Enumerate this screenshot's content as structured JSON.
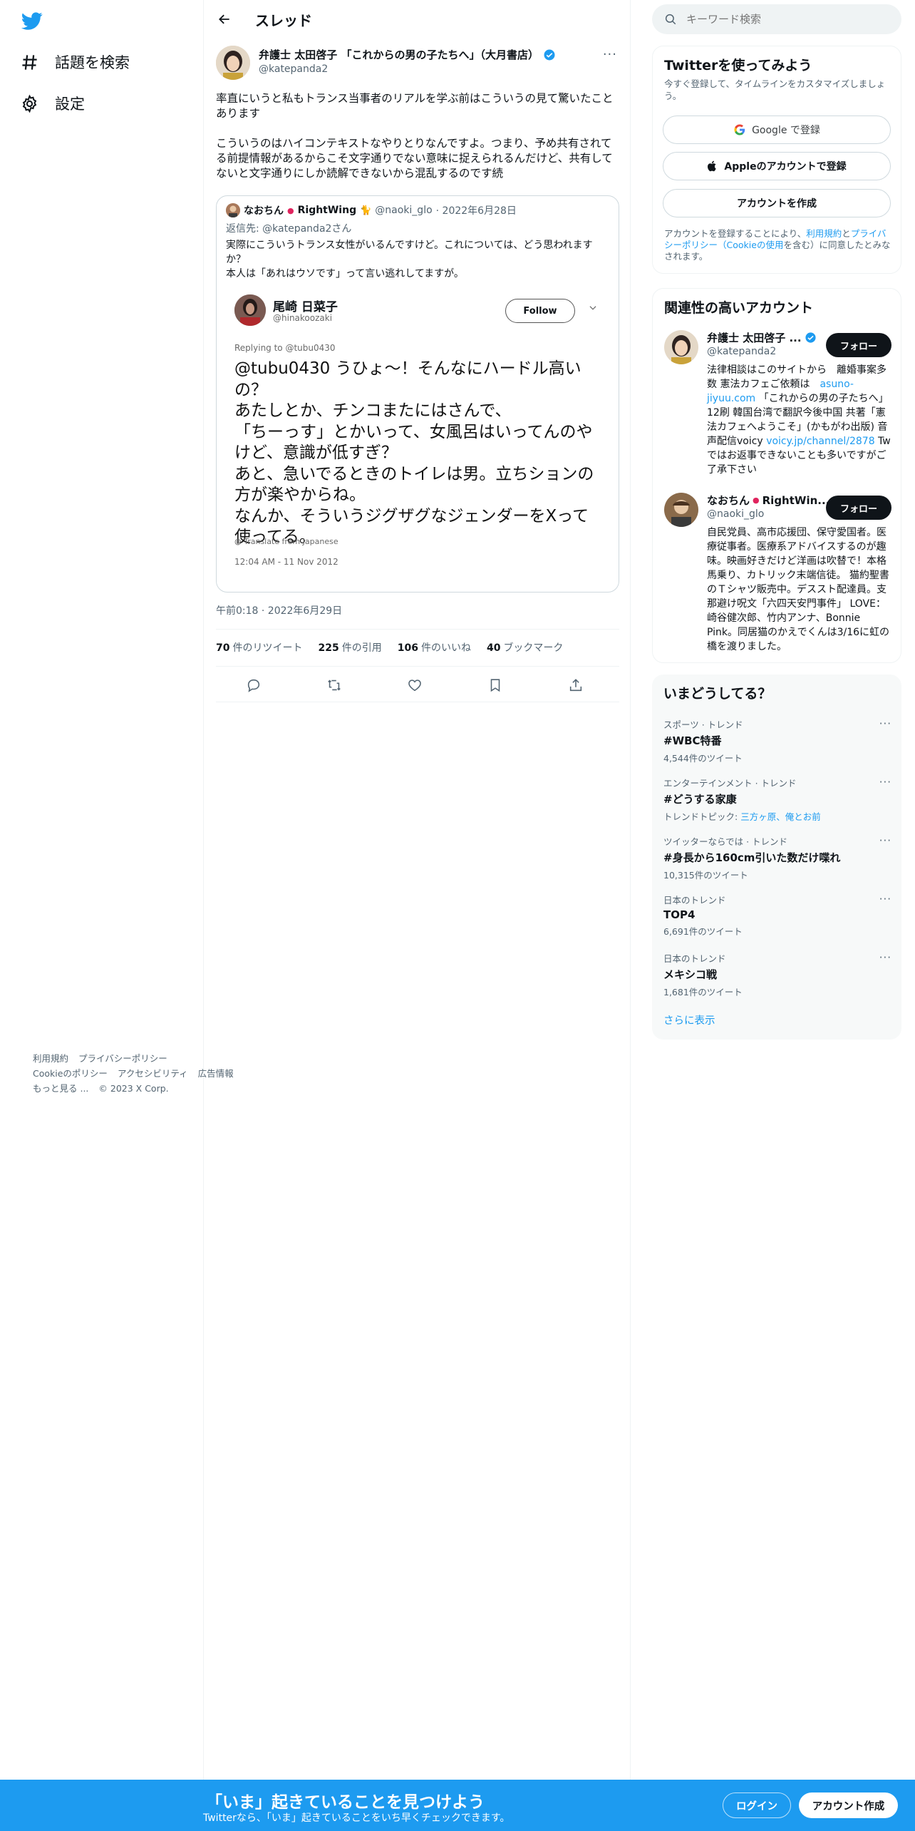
{
  "nav": {
    "items": [
      {
        "label": "話題を検索",
        "icon": "hashtag-icon"
      },
      {
        "label": "設定",
        "icon": "gear-icon"
      }
    ]
  },
  "header": {
    "title": "スレッド"
  },
  "tweet": {
    "author_name": "弁護士 太田啓子 「これからの男の子たちへ」（大月書店）",
    "author_handle": "@katepanda2",
    "text_p1": "率直にいうと私もトランス当事者のリアルを学ぶ前はこういうの見て驚いたことあります",
    "text_p2": "こういうのはハイコンテキストなやりとりなんですよ。つまり、予め共有されてる前提情報があるからこそ文字通りでない意味に捉えられるんだけど、共有してないと文字通りにしか読解できないから混乱するのです続",
    "time": "午前0:18 · 2022年6月29日",
    "stats": {
      "retweets_num": "70",
      "retweets_label": "件のリツイート",
      "quotes_num": "225",
      "quotes_label": "件の引用",
      "likes_num": "106",
      "likes_label": "件のいいね",
      "bookmarks_num": "40",
      "bookmarks_label": "ブックマーク"
    }
  },
  "quote": {
    "name": "なおちん",
    "name_suffix": "RightWing",
    "handle": "@naoki_glo",
    "date": "· 2022年6月28日",
    "reply_label": "返信先:",
    "reply_to": "@katepanda2さん",
    "text_l1": "実際にこういうトランス女性がいるんですけど。これについては、どう思われますか？",
    "text_l2": "本人は「あれはウソです」って言い逃れしてますが。",
    "image": {
      "name": "尾崎 日菜子",
      "handle": "@hinakoozaki",
      "follow": "Follow",
      "replying": "Replying to @tubu0430",
      "body": "@tubu0430 うひょ〜！そんなにハードル高いの？\nあたしとか、チンコまたにはさんで、\n「ちーっす」とかいって、女風呂はいってんのやけど、意識が低すぎ？\nあと、急いでるときのトイレは男。立ちションの方が楽やからね。\nなんか、そういうジグザグなジェンダーをXって使ってる。",
      "translate": "Translate from Japanese",
      "time": "12:04 AM - 11 Nov 2012"
    }
  },
  "search": {
    "placeholder": "キーワード検索"
  },
  "signup": {
    "title": "Twitterを使ってみよう",
    "subtitle": "今すぐ登録して、タイムラインをカスタマイズしましょう。",
    "google": "Google で登録",
    "apple": "Appleのアカウントで登録",
    "create": "アカウントを作成",
    "legal_pre": "アカウントを登録することにより、",
    "legal_terms": "利用規約",
    "legal_and": "と",
    "legal_privacy": "プライバシーポリシー",
    "legal_cookie": "（Cookieの使用",
    "legal_post": "を含む）に同意したとみなされます。"
  },
  "related": {
    "title": "関連性の高いアカウント",
    "follow_label": "フォロー",
    "accounts": [
      {
        "name": "弁護士 太田啓子 ...",
        "handle": "@katepanda2",
        "bio_a": "法律相談はこのサイトから　離婚事案多数 憲法カフェご依頼は　",
        "bio_link1": "asuno-jiyuu.com",
        "bio_b": " 「これからの男の子たちへ」12刷 韓国台湾で翻訳今後中国 共著「憲法カフェへようこそ」(かもがわ出版) 音声配信voicy ",
        "bio_link2": "voicy.jp/channel/2878",
        "bio_c": " Twではお返事できないことも多いですがご了承下さい"
      },
      {
        "name": "なおちん",
        "name_suffix": "RightWin...",
        "handle": "@naoki_glo",
        "bio": "自民党員、高市応援団、保守愛国者。医療従事者。医療系アドバイスするのが趣味。映画好きだけど洋画は吹替で！本格馬乗り、カトリック末端信徒。 猫約聖書のＴシャツ販売中。デススト配達員。支那避け呪文「六四天安門事件」 LOVE：崎谷健次郎、竹内アンナ、Bonnie Pink。同居猫のかえでくんは3/16に虹の橋を渡りました。"
      }
    ]
  },
  "trends": {
    "title": "いまどうしてる？",
    "items": [
      {
        "category": "スポーツ · トレンド",
        "name": "#WBC特番",
        "count": "4,544件のツイート"
      },
      {
        "category": "エンターテインメント · トレンド",
        "name": "#どうする家康",
        "count_pre": "トレンドトピック: ",
        "count_link": "三方ヶ原、俺とお前"
      },
      {
        "category": "ツイッターならでは · トレンド",
        "name": "#身長から160cm引いた数だけ喋れ",
        "count": "10,315件のツイート"
      },
      {
        "category": "日本のトレンド",
        "name": "TOP4",
        "count": "6,691件のツイート"
      },
      {
        "category": "日本のトレンド",
        "name": "メキシコ戦",
        "count": "1,681件のツイート"
      }
    ],
    "show_more": "さらに表示"
  },
  "footer": {
    "links": [
      "利用規約",
      "プライバシーポリシー",
      "Cookieのポリシー",
      "アクセシビリティ",
      "広告情報",
      "もっと見る ...",
      "© 2023 X Corp."
    ]
  },
  "bottombar": {
    "title": "「いま」起きていることを見つけよう",
    "subtitle": "Twitterなら、「いま」起きていることをいち早くチェックできます。",
    "login": "ログイン",
    "signup": "アカウント作成"
  },
  "colors": {
    "accent": "#1d9bf0",
    "text": "#0f1419",
    "muted": "#536471",
    "border": "#eff3f4"
  }
}
